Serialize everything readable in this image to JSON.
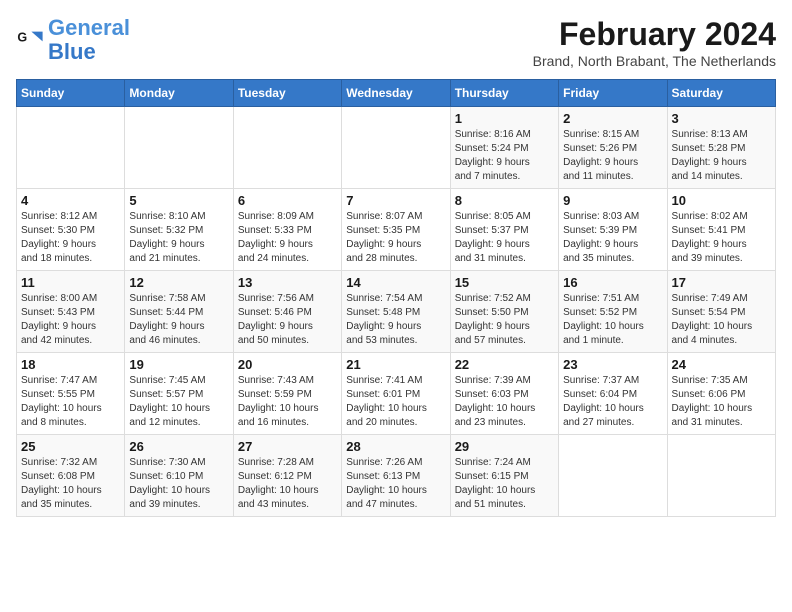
{
  "header": {
    "logo_line1": "General",
    "logo_line2": "Blue",
    "main_title": "February 2024",
    "subtitle": "Brand, North Brabant, The Netherlands"
  },
  "weekdays": [
    "Sunday",
    "Monday",
    "Tuesday",
    "Wednesday",
    "Thursday",
    "Friday",
    "Saturday"
  ],
  "weeks": [
    [
      {
        "day": "",
        "info": ""
      },
      {
        "day": "",
        "info": ""
      },
      {
        "day": "",
        "info": ""
      },
      {
        "day": "",
        "info": ""
      },
      {
        "day": "1",
        "info": "Sunrise: 8:16 AM\nSunset: 5:24 PM\nDaylight: 9 hours\nand 7 minutes."
      },
      {
        "day": "2",
        "info": "Sunrise: 8:15 AM\nSunset: 5:26 PM\nDaylight: 9 hours\nand 11 minutes."
      },
      {
        "day": "3",
        "info": "Sunrise: 8:13 AM\nSunset: 5:28 PM\nDaylight: 9 hours\nand 14 minutes."
      }
    ],
    [
      {
        "day": "4",
        "info": "Sunrise: 8:12 AM\nSunset: 5:30 PM\nDaylight: 9 hours\nand 18 minutes."
      },
      {
        "day": "5",
        "info": "Sunrise: 8:10 AM\nSunset: 5:32 PM\nDaylight: 9 hours\nand 21 minutes."
      },
      {
        "day": "6",
        "info": "Sunrise: 8:09 AM\nSunset: 5:33 PM\nDaylight: 9 hours\nand 24 minutes."
      },
      {
        "day": "7",
        "info": "Sunrise: 8:07 AM\nSunset: 5:35 PM\nDaylight: 9 hours\nand 28 minutes."
      },
      {
        "day": "8",
        "info": "Sunrise: 8:05 AM\nSunset: 5:37 PM\nDaylight: 9 hours\nand 31 minutes."
      },
      {
        "day": "9",
        "info": "Sunrise: 8:03 AM\nSunset: 5:39 PM\nDaylight: 9 hours\nand 35 minutes."
      },
      {
        "day": "10",
        "info": "Sunrise: 8:02 AM\nSunset: 5:41 PM\nDaylight: 9 hours\nand 39 minutes."
      }
    ],
    [
      {
        "day": "11",
        "info": "Sunrise: 8:00 AM\nSunset: 5:43 PM\nDaylight: 9 hours\nand 42 minutes."
      },
      {
        "day": "12",
        "info": "Sunrise: 7:58 AM\nSunset: 5:44 PM\nDaylight: 9 hours\nand 46 minutes."
      },
      {
        "day": "13",
        "info": "Sunrise: 7:56 AM\nSunset: 5:46 PM\nDaylight: 9 hours\nand 50 minutes."
      },
      {
        "day": "14",
        "info": "Sunrise: 7:54 AM\nSunset: 5:48 PM\nDaylight: 9 hours\nand 53 minutes."
      },
      {
        "day": "15",
        "info": "Sunrise: 7:52 AM\nSunset: 5:50 PM\nDaylight: 9 hours\nand 57 minutes."
      },
      {
        "day": "16",
        "info": "Sunrise: 7:51 AM\nSunset: 5:52 PM\nDaylight: 10 hours\nand 1 minute."
      },
      {
        "day": "17",
        "info": "Sunrise: 7:49 AM\nSunset: 5:54 PM\nDaylight: 10 hours\nand 4 minutes."
      }
    ],
    [
      {
        "day": "18",
        "info": "Sunrise: 7:47 AM\nSunset: 5:55 PM\nDaylight: 10 hours\nand 8 minutes."
      },
      {
        "day": "19",
        "info": "Sunrise: 7:45 AM\nSunset: 5:57 PM\nDaylight: 10 hours\nand 12 minutes."
      },
      {
        "day": "20",
        "info": "Sunrise: 7:43 AM\nSunset: 5:59 PM\nDaylight: 10 hours\nand 16 minutes."
      },
      {
        "day": "21",
        "info": "Sunrise: 7:41 AM\nSunset: 6:01 PM\nDaylight: 10 hours\nand 20 minutes."
      },
      {
        "day": "22",
        "info": "Sunrise: 7:39 AM\nSunset: 6:03 PM\nDaylight: 10 hours\nand 23 minutes."
      },
      {
        "day": "23",
        "info": "Sunrise: 7:37 AM\nSunset: 6:04 PM\nDaylight: 10 hours\nand 27 minutes."
      },
      {
        "day": "24",
        "info": "Sunrise: 7:35 AM\nSunset: 6:06 PM\nDaylight: 10 hours\nand 31 minutes."
      }
    ],
    [
      {
        "day": "25",
        "info": "Sunrise: 7:32 AM\nSunset: 6:08 PM\nDaylight: 10 hours\nand 35 minutes."
      },
      {
        "day": "26",
        "info": "Sunrise: 7:30 AM\nSunset: 6:10 PM\nDaylight: 10 hours\nand 39 minutes."
      },
      {
        "day": "27",
        "info": "Sunrise: 7:28 AM\nSunset: 6:12 PM\nDaylight: 10 hours\nand 43 minutes."
      },
      {
        "day": "28",
        "info": "Sunrise: 7:26 AM\nSunset: 6:13 PM\nDaylight: 10 hours\nand 47 minutes."
      },
      {
        "day": "29",
        "info": "Sunrise: 7:24 AM\nSunset: 6:15 PM\nDaylight: 10 hours\nand 51 minutes."
      },
      {
        "day": "",
        "info": ""
      },
      {
        "day": "",
        "info": ""
      }
    ]
  ]
}
